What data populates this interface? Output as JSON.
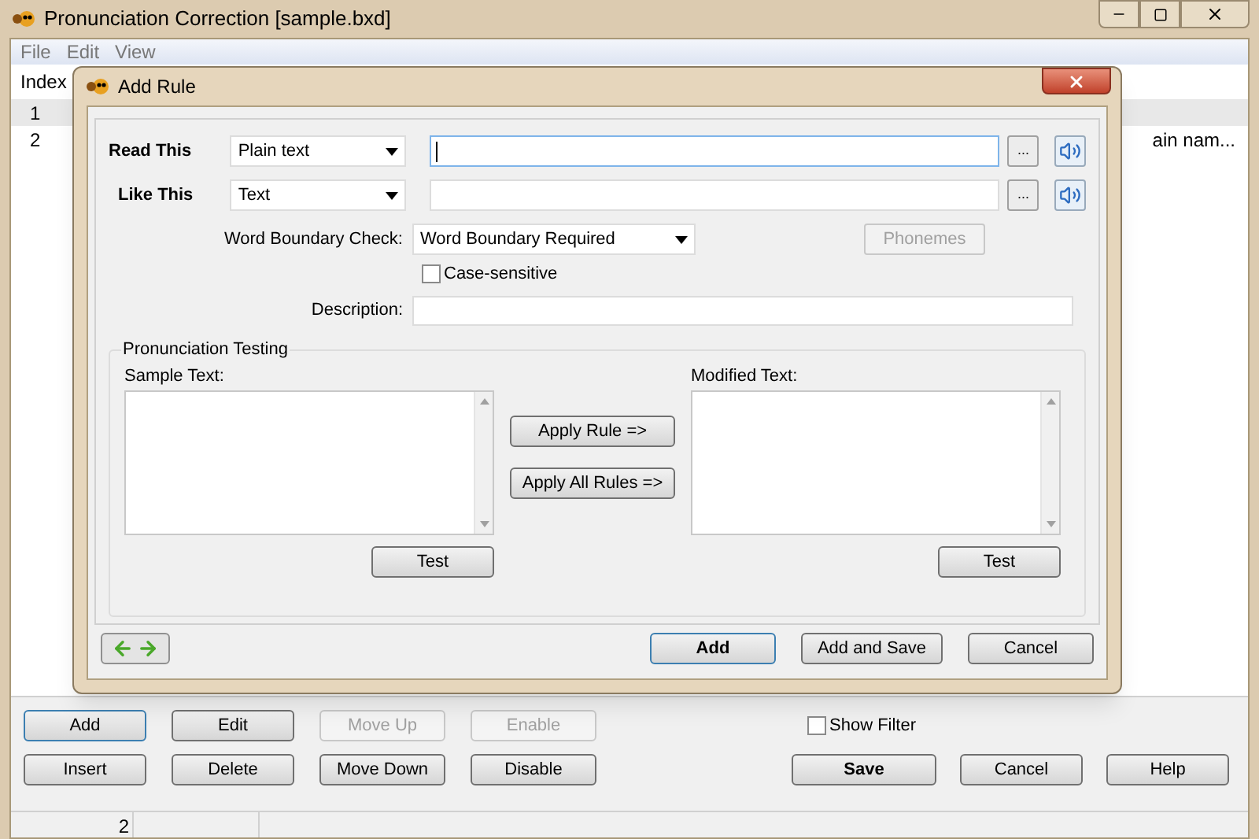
{
  "window": {
    "title": "Pronunciation Correction [sample.bxd]"
  },
  "menu": [
    "File",
    "Edit",
    "View"
  ],
  "table": {
    "columns": [
      "Index"
    ],
    "rows": [
      {
        "index": "1",
        "selected": true
      },
      {
        "index": "2",
        "column_5": "ain nam...",
        "selected": false
      }
    ]
  },
  "dialog": {
    "title": "Add Rule",
    "rows": [
      {
        "label": "Read This",
        "mode": "Plain text",
        "focused": true,
        "browse": "..."
      },
      {
        "label": "Like This",
        "mode": "Text",
        "focused": false,
        "browse": "..."
      }
    ],
    "word_boundary": {
      "label": "Word Boundary Check:",
      "value": "Word Boundary Required"
    },
    "phonemes_button": {
      "label": "Phonemes",
      "disabled": true
    },
    "case_sensitive": {
      "label": "Case-sensitive",
      "checked": false
    },
    "description": {
      "label": "Description:"
    },
    "testing": {
      "title": "Pronunciation Testing",
      "sample_label": "Sample Text:",
      "modified_label": "Modified Text:",
      "test_buttons": [
        "Test",
        "Test"
      ],
      "apply_buttons": [
        "Apply Rule =>",
        "Apply All Rules =>"
      ]
    },
    "footer_buttons": [
      {
        "label": "Add",
        "default": true
      },
      {
        "label": "Add and Save",
        "default": false
      },
      {
        "label": "Cancel",
        "default": false
      }
    ]
  },
  "buttons": [
    [
      {
        "label": "Add",
        "disabled": false,
        "focused": true
      },
      {
        "label": "Edit",
        "disabled": false,
        "focused": false
      },
      {
        "label": "Move Up",
        "disabled": true,
        "focused": false
      },
      {
        "label": "Enable",
        "disabled": true,
        "focused": false
      }
    ],
    [
      {
        "label": "Insert",
        "disabled": false,
        "focused": false
      },
      {
        "label": "Delete",
        "disabled": false,
        "focused": false
      },
      {
        "label": "Move Down",
        "disabled": false,
        "focused": false
      },
      {
        "label": "Disable",
        "disabled": false,
        "focused": false
      }
    ]
  ],
  "show_filter": {
    "label": "Show Filter",
    "checked": false
  },
  "action_buttons": [
    {
      "label": "Save",
      "default": true
    },
    {
      "label": "Cancel",
      "default": false
    },
    {
      "label": "Help",
      "default": false
    }
  ],
  "status_bar": [
    "2"
  ]
}
